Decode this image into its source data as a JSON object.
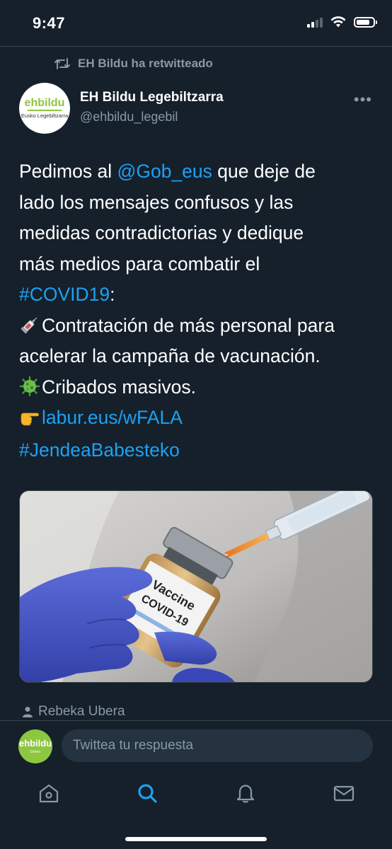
{
  "status_bar": {
    "time": "9:47",
    "icons": [
      "cellular-signal-icon",
      "wifi-icon",
      "battery-icon"
    ],
    "battery_level": 0.85
  },
  "retweet": {
    "icon": "retweet-icon",
    "label": "EH Bildu ha retwitteado"
  },
  "author": {
    "name": "EH Bildu Legebiltzarra",
    "handle": "@ehbildu_legebil",
    "avatar_logo_text": "ehbildu",
    "avatar_logo_subtext": "Eusko Legebiltzarra",
    "more_icon": "more-icon",
    "more_label": "•••"
  },
  "tweet": {
    "line1_pre": "Pedimos al ",
    "mention": "@Gob_eus",
    "line1_post": " que deje de",
    "line2": "lado los mensajes confusos y las",
    "line3": "medidas contradictorias y dedique",
    "line4": "más medios para combatir el",
    "hashtag_covid": "#COVID19",
    "hashtag_covid_suffix": ":",
    "bullet1": "Contratación de más personal para",
    "bullet1_cont": "acelerar la campaña de vacunación.",
    "bullet2": "Cribados masivos.",
    "link": "labur.eus/wFALA",
    "hashtag_final": "#JendeaBabesteko",
    "emoji_syringe": "syringe-emoji",
    "emoji_virus": "microbe-emoji",
    "emoji_point": "pointing-hand-emoji"
  },
  "media": {
    "vial_label_line1": "Vaccine",
    "vial_label_line2": "COVID-19"
  },
  "tagged": {
    "icon": "person-icon",
    "name": "Rebeka Ubera"
  },
  "reply": {
    "placeholder": "Twittea tu respuesta",
    "avatar_logo_text": "ehbildu",
    "avatar_logo_subtext": "Getxo"
  },
  "tab_bar": {
    "tabs": [
      {
        "icon": "home-icon",
        "active": false
      },
      {
        "icon": "search-icon",
        "active": true
      },
      {
        "icon": "notifications-bell-icon",
        "active": false
      },
      {
        "icon": "messages-envelope-icon",
        "active": false
      }
    ]
  },
  "colors": {
    "background": "#15202b",
    "link": "#1da1f2",
    "secondary_text": "#8899a6",
    "divider": "#38444d",
    "brand_green": "#8dc63f"
  }
}
